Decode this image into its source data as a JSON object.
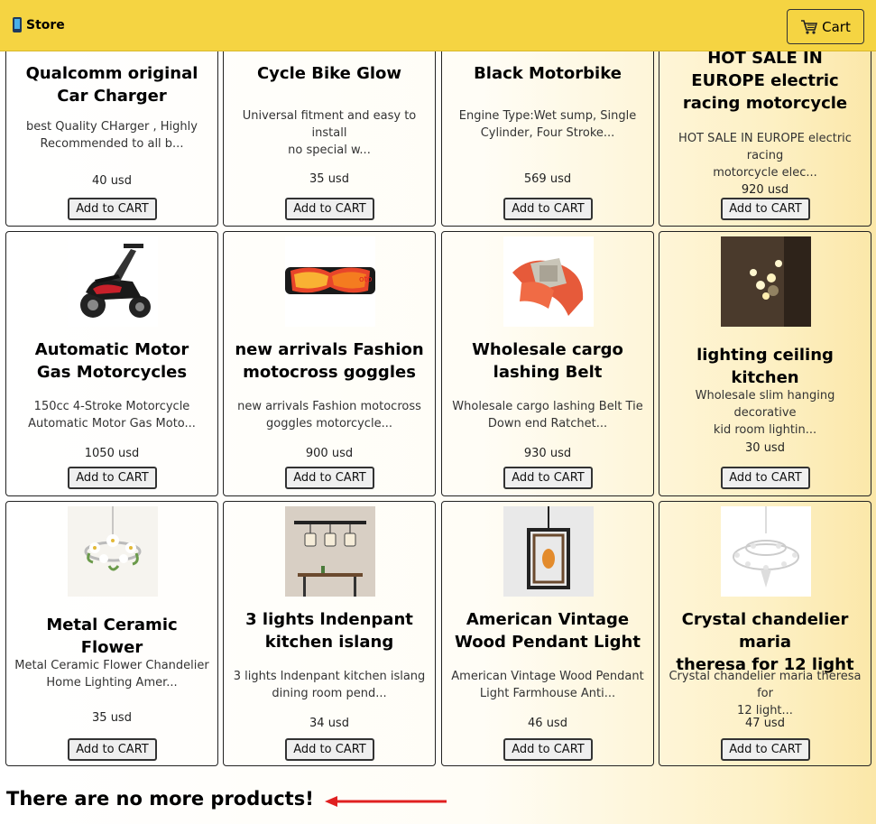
{
  "header": {
    "brand_icon": "phone-icon",
    "brand_label": "Store",
    "cart_icon": "cart-icon",
    "cart_label": "Cart",
    "background_color": "#f5d442"
  },
  "products": [
    {
      "title_lines": [
        "Qualcomm original",
        "Car Charger"
      ],
      "desc_lines": [
        "best Quality CHarger , Highly",
        "Recommended to all b..."
      ],
      "price": "40 usd",
      "button": "Add to CART",
      "image": "none"
    },
    {
      "title_lines": [
        "Cycle Bike Glow"
      ],
      "desc_lines": [
        "Universal fitment and easy to install",
        "no special w..."
      ],
      "price": "35 usd",
      "button": "Add to CART",
      "image": "none"
    },
    {
      "title_lines": [
        "Black Motorbike"
      ],
      "desc_lines": [
        "Engine Type:Wet sump, Single",
        "Cylinder, Four Stroke..."
      ],
      "price": "569 usd",
      "button": "Add to CART",
      "image": "none"
    },
    {
      "title_lines": [
        "HOT SALE IN",
        "EUROPE electric",
        "racing motorcycle"
      ],
      "desc_lines": [
        "HOT SALE IN EUROPE electric racing",
        "motorcycle elec..."
      ],
      "price": "920 usd",
      "button": "Add to CART",
      "image": "none"
    },
    {
      "title_lines": [
        "Automatic Motor",
        "Gas Motorcycles"
      ],
      "desc_lines": [
        "150cc 4-Stroke Motorcycle",
        "Automatic Motor Gas Moto..."
      ],
      "price": "1050 usd",
      "button": "Add to CART",
      "image": "scooter-image"
    },
    {
      "title_lines": [
        "new arrivals Fashion",
        "motocross goggles"
      ],
      "desc_lines": [
        "new arrivals Fashion motocross",
        "goggles motorcycle..."
      ],
      "price": "900 usd",
      "button": "Add to CART",
      "image": "goggles-image"
    },
    {
      "title_lines": [
        "Wholesale cargo",
        "lashing Belt"
      ],
      "desc_lines": [
        "Wholesale cargo lashing Belt Tie",
        "Down end Ratchet..."
      ],
      "price": "930 usd",
      "button": "Add to CART",
      "image": "belt-image"
    },
    {
      "title_lines": [
        "lighting ceiling kitchen"
      ],
      "desc_lines": [
        "Wholesale slim hanging decorative",
        "kid room lightin..."
      ],
      "price": "30 usd",
      "button": "Add to CART",
      "image": "ceiling-light-image"
    },
    {
      "title_lines": [
        "Metal Ceramic Flower"
      ],
      "desc_lines": [
        "Metal Ceramic Flower Chandelier",
        "Home Lighting Amer..."
      ],
      "price": "35 usd",
      "button": "Add to CART",
      "image": "flower-chandelier-image"
    },
    {
      "title_lines": [
        "3 lights lndenpant",
        "kitchen islang"
      ],
      "desc_lines": [
        "3 lights lndenpant kitchen islang",
        "dining room pend..."
      ],
      "price": "34 usd",
      "button": "Add to CART",
      "image": "pendant-lights-image"
    },
    {
      "title_lines": [
        "American Vintage",
        "Wood Pendant Light"
      ],
      "desc_lines": [
        "American Vintage Wood Pendant",
        "Light Farmhouse Anti..."
      ],
      "price": "46 usd",
      "button": "Add to CART",
      "image": "wood-pendant-image"
    },
    {
      "title_lines": [
        "Crystal chandelier maria",
        "theresa for 12 light"
      ],
      "desc_lines": [
        "Crystal chandelier maria theresa for",
        "12 light..."
      ],
      "price": "47 usd",
      "button": "Add to CART",
      "image": "crystal-chandelier-image"
    }
  ],
  "footer": {
    "message": "There are no more products!",
    "annotation": "arrow-pointer",
    "annotation_color": "#e02020"
  }
}
